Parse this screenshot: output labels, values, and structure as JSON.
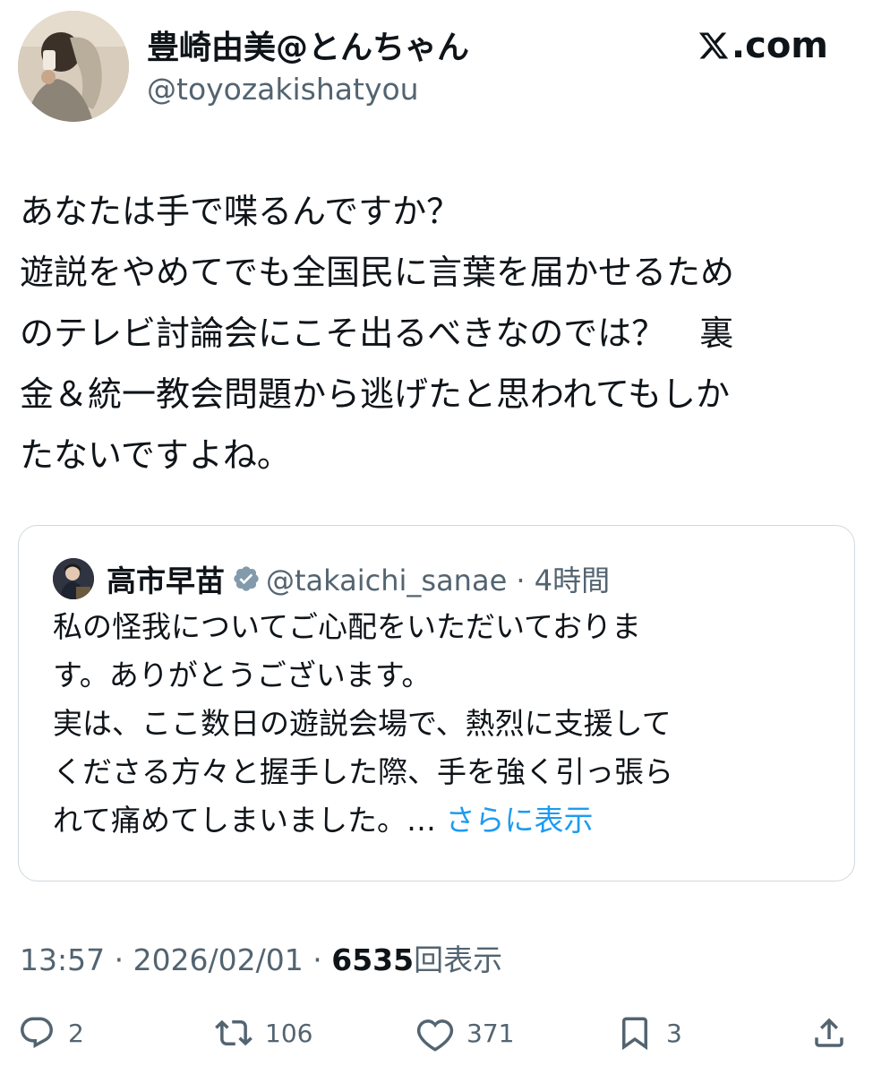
{
  "author": {
    "display_name": "豊崎由美@とんちゃん",
    "handle": "@toyozakishatyou"
  },
  "brand": {
    "label": ".com",
    "icon": "x-logo-icon"
  },
  "tweet": {
    "lines": [
      "あなたは手で喋るんですか？",
      "遊説をやめてでも全国民に言葉を届かせるため",
      "のテレビ討論会にこそ出るべきなのでは？　裏",
      "金＆統一教会問題から逃げたと思われてもしか",
      "たないですよね。"
    ]
  },
  "quote": {
    "name": "高市早苗",
    "verified_icon": "verified-badge-icon",
    "handle_time": "@takaichi_sanae · 4時間",
    "lines": [
      "私の怪我についてご心配をいただいておりま",
      "す。ありがとうございます。",
      "実は、ここ数日の遊説会場で、熱烈に支援して",
      "くださる方々と握手した際、手を強く引っ張ら"
    ],
    "last_line": "れて痛めてしまいました。…",
    "show_more": "さらに表示"
  },
  "meta": {
    "timestamp": "13:57 · 2026/02/01 · ",
    "views_count": "6535",
    "views_label": "回表示"
  },
  "actions": {
    "reply_count": "2",
    "retweet_count": "106",
    "like_count": "371",
    "bookmark_count": "3"
  },
  "colors": {
    "text": "#0f1419",
    "secondary": "#536471",
    "link": "#1d9bf0",
    "border": "#cfd9de"
  }
}
